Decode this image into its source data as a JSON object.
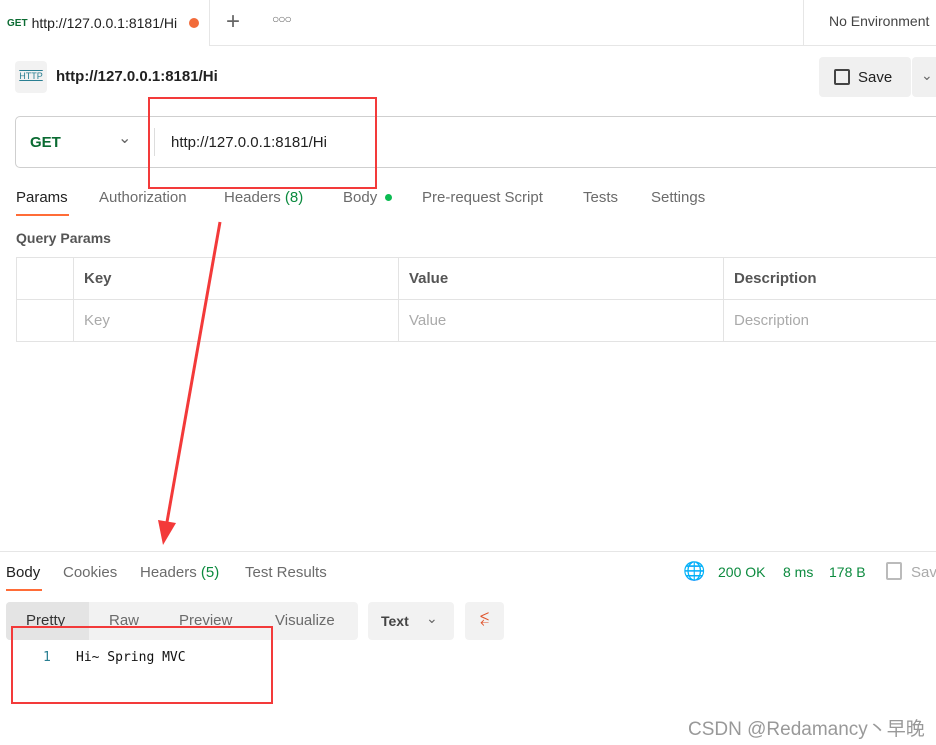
{
  "tab": {
    "method": "GET",
    "url": "http://127.0.0.1:8181/Hi"
  },
  "environment": "No Environment",
  "request": {
    "title": "http://127.0.0.1:8181/Hi",
    "icon_label": "HTTP",
    "save_label": "Save",
    "method": "GET",
    "url": "http://127.0.0.1:8181/Hi"
  },
  "req_tabs": {
    "params": "Params",
    "auth": "Authorization",
    "headers": "Headers",
    "headers_count": "(8)",
    "body": "Body",
    "prereq": "Pre-request Script",
    "tests": "Tests",
    "settings": "Settings"
  },
  "query": {
    "title": "Query Params",
    "headers": [
      "Key",
      "Value",
      "Description"
    ],
    "placeholders": [
      "Key",
      "Value",
      "Description"
    ]
  },
  "response": {
    "tabs": {
      "body": "Body",
      "cookies": "Cookies",
      "headers": "Headers",
      "headers_count": "(5)",
      "tests": "Test Results"
    },
    "status": "200 OK",
    "time": "8 ms",
    "size": "178 B",
    "save": "Save",
    "views": [
      "Pretty",
      "Raw",
      "Preview",
      "Visualize"
    ],
    "format": "Text",
    "line_no": "1",
    "content": "Hi~ Spring MVC"
  },
  "watermark": "CSDN @Redamancy丶早晚",
  "colors": {
    "accent": "#ff6c37",
    "green": "#0b8a3e",
    "annotation": "#f33a3a"
  }
}
